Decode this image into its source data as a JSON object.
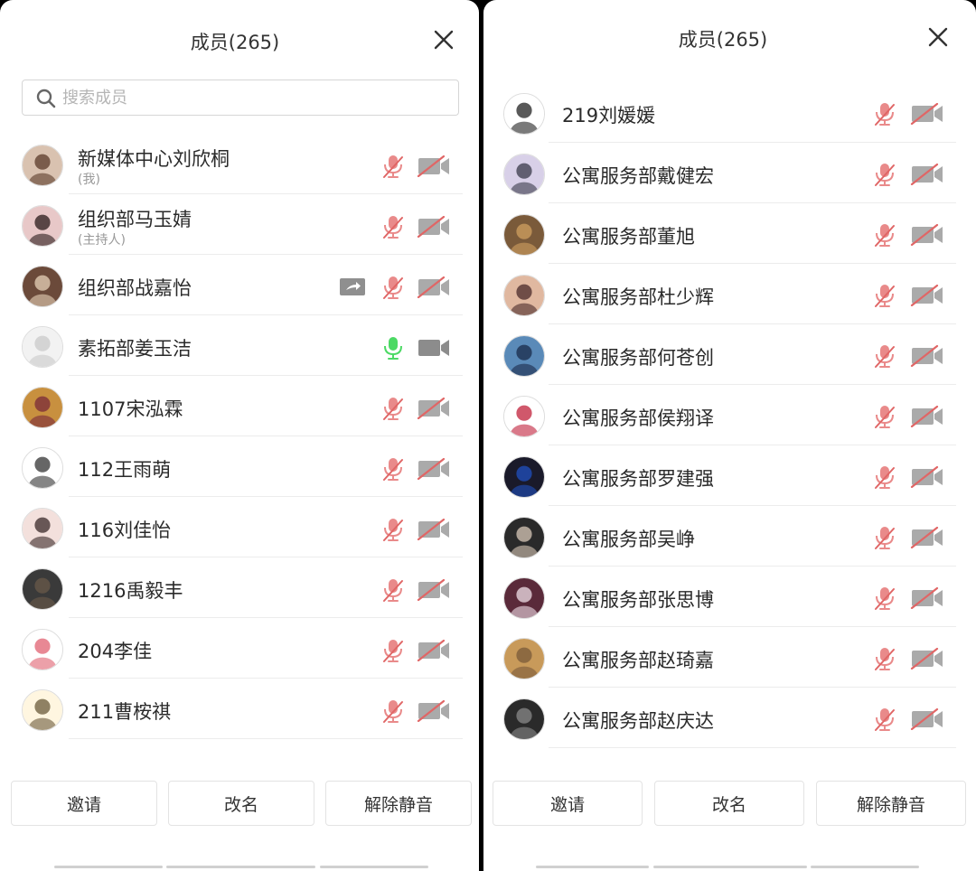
{
  "left_panel": {
    "title": "成员(265)",
    "search_placeholder": "搜索成员",
    "members": [
      {
        "name": "新媒体中心刘欣桐",
        "sub": "(我)",
        "mic": "muted",
        "cam": "off",
        "avatar": "a1"
      },
      {
        "name": "组织部马玉婧",
        "sub": "(主持人)",
        "mic": "muted",
        "cam": "off",
        "avatar": "a2"
      },
      {
        "name": "组织部战嘉怡",
        "mic": "muted",
        "cam": "off",
        "share": true,
        "avatar": "a3"
      },
      {
        "name": "素拓部姜玉洁",
        "mic": "active",
        "cam": "on",
        "avatar": "a4"
      },
      {
        "name": "1107宋泓霖",
        "mic": "muted",
        "cam": "off",
        "avatar": "a5"
      },
      {
        "name": "112王雨萌",
        "mic": "muted",
        "cam": "off",
        "avatar": "a6"
      },
      {
        "name": "116刘佳怡",
        "mic": "muted",
        "cam": "off",
        "avatar": "a7"
      },
      {
        "name": "1216禹毅丰",
        "mic": "muted",
        "cam": "off",
        "avatar": "a8"
      },
      {
        "name": "204李佳",
        "mic": "muted",
        "cam": "off",
        "avatar": "a9"
      },
      {
        "name": "211曹桉祺",
        "mic": "muted",
        "cam": "off",
        "avatar": "a10"
      }
    ],
    "buttons": {
      "invite": "邀请",
      "rename": "改名",
      "unmute": "解除静音"
    }
  },
  "right_panel": {
    "title": "成员(265)",
    "members": [
      {
        "name": "219刘媛媛",
        "mic": "muted",
        "cam": "off",
        "avatar": "b1"
      },
      {
        "name": "公寓服务部戴健宏",
        "mic": "muted",
        "cam": "off",
        "avatar": "b2"
      },
      {
        "name": "公寓服务部董旭",
        "mic": "muted",
        "cam": "off",
        "avatar": "b3"
      },
      {
        "name": "公寓服务部杜少辉",
        "mic": "muted",
        "cam": "off",
        "avatar": "b4"
      },
      {
        "name": "公寓服务部何苍创",
        "mic": "muted",
        "cam": "off",
        "avatar": "b5"
      },
      {
        "name": "公寓服务部侯翔译",
        "mic": "muted",
        "cam": "off",
        "avatar": "b6"
      },
      {
        "name": "公寓服务部罗建强",
        "mic": "muted",
        "cam": "off",
        "avatar": "b7"
      },
      {
        "name": "公寓服务部吴峥",
        "mic": "muted",
        "cam": "off",
        "avatar": "b8"
      },
      {
        "name": "公寓服务部张思博",
        "mic": "muted",
        "cam": "off",
        "avatar": "b9"
      },
      {
        "name": "公寓服务部赵琦嘉",
        "mic": "muted",
        "cam": "off",
        "avatar": "b10"
      },
      {
        "name": "公寓服务部赵庆达",
        "mic": "muted",
        "cam": "off",
        "avatar": "b11"
      }
    ],
    "buttons": {
      "invite": "邀请",
      "rename": "改名",
      "unmute": "解除静音"
    }
  },
  "colors": {
    "muted_icon": "#e98a8a",
    "icon_gray": "#aaaaaa",
    "active_mic": "#4cd964",
    "camera_on": "#8c8c8c"
  },
  "avatar_colors": {
    "a1": [
      "#d9c2b0",
      "#5a3a2a"
    ],
    "a2": [
      "#e8c8c8",
      "#2a1a1a"
    ],
    "a3": [
      "#6b4a3a",
      "#e6d2b8"
    ],
    "a4": [
      "#f2f2f2",
      "#c9c9c9"
    ],
    "a5": [
      "#c8903f",
      "#7a2a3a"
    ],
    "a6": [
      "#ffffff",
      "#333333"
    ],
    "a7": [
      "#f3e0dc",
      "#3a2a2a"
    ],
    "a8": [
      "#3a3a3a",
      "#6a5a4a"
    ],
    "a9": [
      "#ffffff",
      "#e06070"
    ],
    "a10": [
      "#fff6e0",
      "#6a5a3a"
    ],
    "b1": [
      "#ffffff",
      "#222222"
    ],
    "b2": [
      "#d8d0e8",
      "#3a3a4a"
    ],
    "b3": [
      "#7a5a3a",
      "#d0a060"
    ],
    "b4": [
      "#e0b8a0",
      "#4a2a2a"
    ],
    "b5": [
      "#5a8ab8",
      "#1a2a4a"
    ],
    "b6": [
      "#ffffff",
      "#c0203a"
    ],
    "b7": [
      "#1a1a2a",
      "#2050c0"
    ],
    "b8": [
      "#2a2a2a",
      "#d8c8b8"
    ],
    "b9": [
      "#5a2a3a",
      "#f0e0e8"
    ],
    "b10": [
      "#c89a5a",
      "#7a5a3a"
    ],
    "b11": [
      "#2a2a2a",
      "#8a8a8a"
    ]
  }
}
